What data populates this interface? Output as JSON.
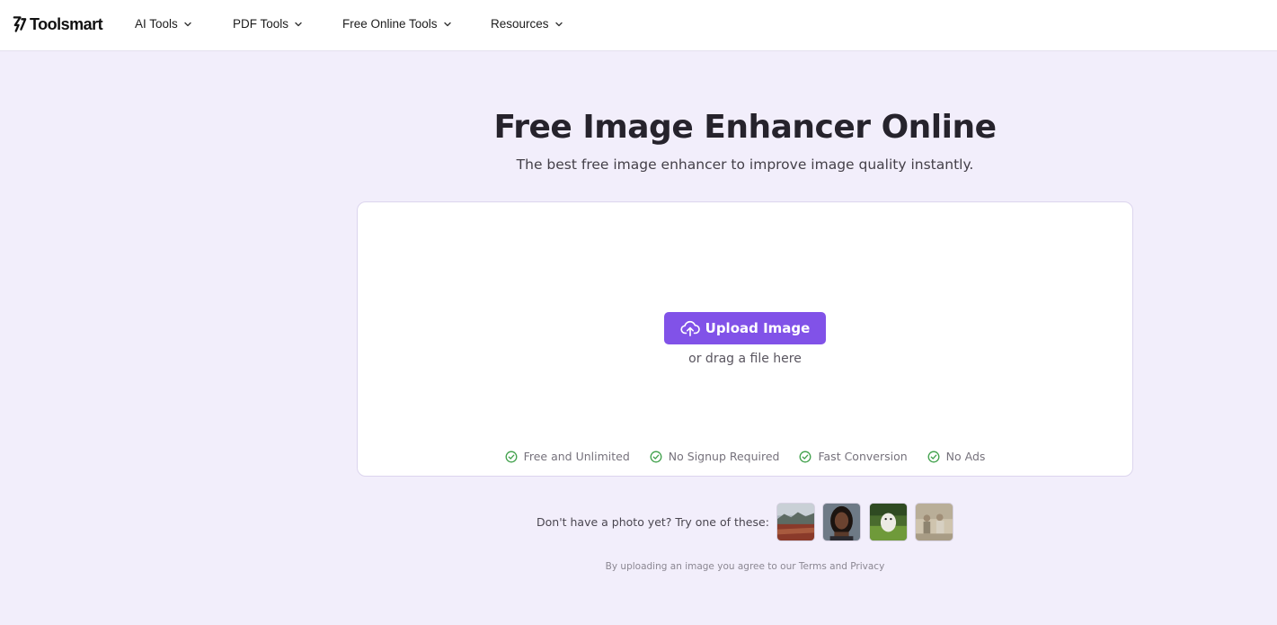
{
  "header": {
    "logo_text": "Toolsmart",
    "nav": [
      {
        "label": "AI Tools"
      },
      {
        "label": "PDF Tools"
      },
      {
        "label": "Free Online Tools"
      },
      {
        "label": "Resources"
      }
    ]
  },
  "hero": {
    "title": "Free Image Enhancer Online",
    "subtitle": "The best free image enhancer to improve image quality instantly."
  },
  "upload": {
    "button_label": "Upload Image",
    "drag_text": "or drag a file here",
    "features": [
      {
        "label": "Free and Unlimited"
      },
      {
        "label": "No Signup Required"
      },
      {
        "label": "Fast Conversion"
      },
      {
        "label": "No Ads"
      }
    ]
  },
  "samples": {
    "label": "Don't have a photo yet? Try one of these:"
  },
  "terms": {
    "prefix": "By uploading an image you agree to our ",
    "terms_link": "Terms",
    "and": " and ",
    "privacy_link": "Privacy"
  },
  "colors": {
    "accent": "#8152e8",
    "background": "#f2eefb",
    "check": "#3fa04a"
  }
}
